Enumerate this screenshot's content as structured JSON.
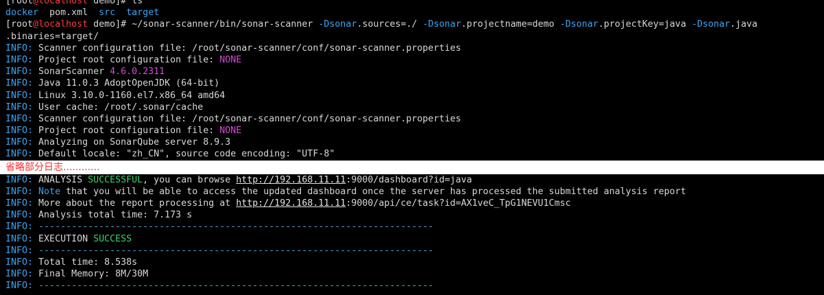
{
  "prompt1": {
    "user": "root",
    "at": "@",
    "host": "localhost",
    "dir": "demo",
    "cmd": "ls"
  },
  "ls_items": [
    {
      "name": "docker",
      "kind": "dir"
    },
    {
      "name": "pom.xml",
      "kind": "file"
    },
    {
      "name": "src",
      "kind": "dir"
    },
    {
      "name": "target",
      "kind": "dir"
    }
  ],
  "prompt2": {
    "user": "root",
    "at": "@",
    "host": "localhost",
    "dir": "demo",
    "cmd_path": "~/sonar-scanner/bin/sonar-scanner",
    "arg1_flag": "-Dsonar",
    "arg1_rest": ".sources=./",
    "arg2_flag": "-Dsonar",
    "arg2_rest": ".projectname=demo",
    "arg3_flag": "-Dsonar",
    "arg3_rest": ".projectKey=java",
    "arg4_flag": "-Dsonar",
    "arg4_rest": ".java",
    "wrap": ".binaries=target/"
  },
  "prefix": "INFO:",
  "lines_before": {
    "l1": "Scanner configuration file: /root/sonar-scanner/conf/sonar-scanner.properties",
    "l2_text": "Project root configuration file: ",
    "l2_value": "NONE",
    "l3_text": "SonarScanner ",
    "l3_value": "4.6.0.2311",
    "l4": "Java 11.0.3 AdoptOpenJDK (64-bit)",
    "l5": "Linux 3.10.0-1160.el7.x86_64 amd64",
    "l6": "User cache: /root/.sonar/cache",
    "l7": "Scanner configuration file: /root/sonar-scanner/conf/sonar-scanner.properties",
    "l8_text": "Project root configuration file: ",
    "l8_value": "NONE",
    "l9": "Analyzing on SonarQube server 8.9.3",
    "l10": "Default locale: \"zh_CN\", source code encoding: \"UTF-8\""
  },
  "omitted_note": "省略部分日志............",
  "lines_after": {
    "a1_text": "ANALYSIS ",
    "a1_status": "SUCCESSFUL",
    "a1_mid": ", you can browse ",
    "a1_url": "http://192.168.11.11",
    "a1_tail": ":9000/dashboard?id=java",
    "a2_note": "Note",
    "a2_text": " that you will be able to access the updated dashboard once the server has processed the submitted analysis report",
    "a3_text": "More about the report processing at ",
    "a3_url": "http://192.168.11.11",
    "a3_tail": ":9000/api/ce/task?id=AX1veC_TpG1NEVU1Cmsc",
    "a4": "Analysis total time: 7.173 s",
    "sep": "------------------------------------------------------------------------",
    "exec_text": "EXECUTION ",
    "exec_status": "SUCCESS",
    "total": "Total time: 8.538s",
    "memory": "Final Memory: 8M/30M"
  }
}
